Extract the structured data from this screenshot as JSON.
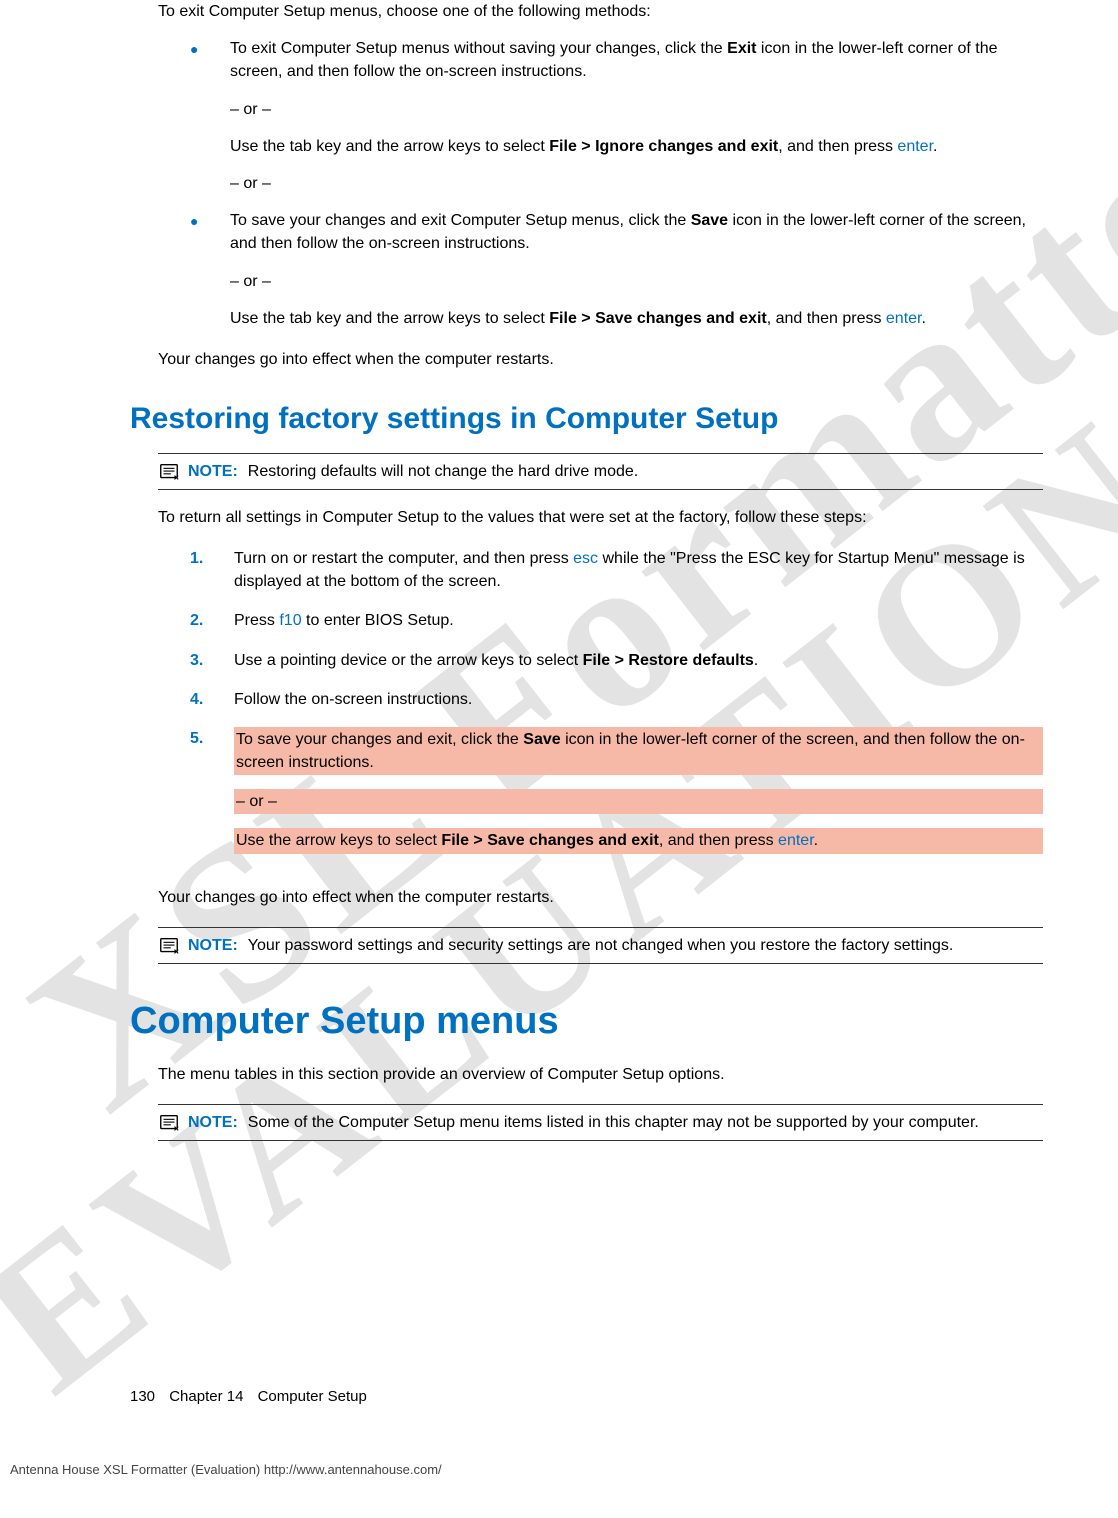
{
  "watermark": {
    "line1": "XSL Formatter",
    "line2": "EVALUATION"
  },
  "intro": "To exit Computer Setup menus, choose one of the following methods:",
  "or": "– or –",
  "bullet1": {
    "p1_a": "To exit Computer Setup menus without saving your changes, click the ",
    "p1_b": "Exit",
    "p1_c": " icon in the lower-left corner of the screen, and then follow the on-screen instructions.",
    "p2_a": "Use the tab key and the arrow keys to select ",
    "p2_b": "File > Ignore changes and exit",
    "p2_c": ", and then press ",
    "p2_d": "enter",
    "p2_e": "."
  },
  "bullet2": {
    "p1_a": "To save your changes and exit Computer Setup menus, click the ",
    "p1_b": "Save",
    "p1_c": " icon in the lower-left corner of the screen, and then follow the on-screen instructions.",
    "p2_a": "Use the tab key and the arrow keys to select ",
    "p2_b": "File > Save changes and exit",
    "p2_c": ", and then press ",
    "p2_d": "enter",
    "p2_e": "."
  },
  "effect": "Your changes go into effect when the computer restarts.",
  "h2": "Restoring factory settings in Computer Setup",
  "note1": {
    "label": "NOTE:",
    "text": "Restoring defaults will not change the hard drive mode."
  },
  "restore_intro": "To return all settings in Computer Setup to the values that were set at the factory, follow these steps:",
  "steps": {
    "s1": {
      "num": "1.",
      "a": "Turn on or restart the computer, and then press ",
      "b": "esc",
      "c": " while the \"Press the ESC key for Startup Menu\" message is displayed at the bottom of the screen."
    },
    "s2": {
      "num": "2.",
      "a": "Press ",
      "b": "f10",
      "c": " to enter BIOS Setup."
    },
    "s3": {
      "num": "3.",
      "a": "Use a pointing device or the arrow keys to select ",
      "b": "File > Restore defaults",
      "c": "."
    },
    "s4": {
      "num": "4.",
      "a": "Follow the on-screen instructions."
    },
    "s5": {
      "num": "5.",
      "p1_a": "To save your changes and exit, click the ",
      "p1_b": "Save",
      "p1_c": " icon in the lower-left corner of the screen, and then follow the on-screen instructions.",
      "p2_a": "Use the arrow keys to select ",
      "p2_b": "File > Save changes and exit",
      "p2_c": ", and then press ",
      "p2_d": "enter",
      "p2_e": "."
    }
  },
  "note2": {
    "label": "NOTE:",
    "text": "Your password settings and security settings are not changed when you restore the factory settings."
  },
  "h1": "Computer Setup menus",
  "menus_intro": "The menu tables in this section provide an overview of Computer Setup options.",
  "note3": {
    "label": "NOTE:",
    "text": "Some of the Computer Setup menu items listed in this chapter may not be supported by your computer."
  },
  "footer": {
    "page": "130",
    "chapter": "Chapter 14",
    "title": "Computer Setup"
  },
  "eval": "Antenna House XSL Formatter (Evaluation)  http://www.antennahouse.com/"
}
